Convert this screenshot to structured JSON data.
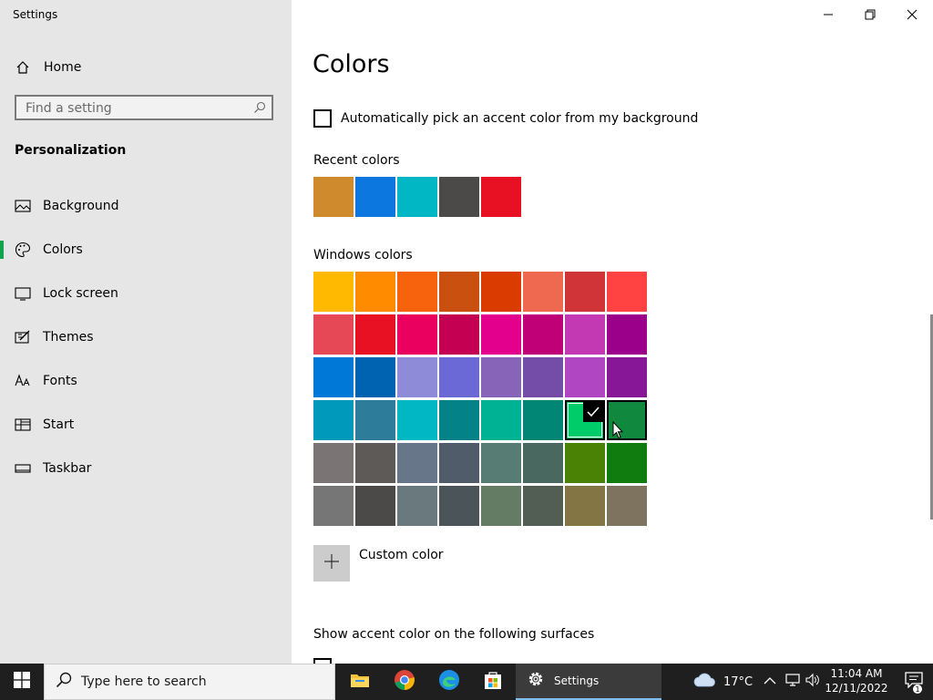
{
  "window": {
    "title": "Settings"
  },
  "sidebar": {
    "home_label": "Home",
    "search_placeholder": "Find a setting",
    "section_title": "Personalization",
    "items": [
      {
        "label": "Background",
        "icon": "image-icon"
      },
      {
        "label": "Colors",
        "icon": "palette-icon",
        "active": true
      },
      {
        "label": "Lock screen",
        "icon": "lock-screen-icon"
      },
      {
        "label": "Themes",
        "icon": "themes-icon"
      },
      {
        "label": "Fonts",
        "icon": "fonts-icon"
      },
      {
        "label": "Start",
        "icon": "start-icon"
      },
      {
        "label": "Taskbar",
        "icon": "taskbar-icon"
      }
    ]
  },
  "main": {
    "title": "Colors",
    "auto_pick_label": "Automatically pick an accent color from my background",
    "recent_label": "Recent colors",
    "recent_colors": [
      "#ce8a2d",
      "#0c77df",
      "#00b7c3",
      "#4b4a48",
      "#e81123"
    ],
    "windows_label": "Windows colors",
    "windows_colors": [
      [
        "#ffb900",
        "#ff8c00",
        "#f7630c",
        "#ca5010",
        "#da3b01",
        "#ef6950",
        "#d13438",
        "#ff4343"
      ],
      [
        "#e74856",
        "#e81123",
        "#ea005e",
        "#c30052",
        "#e3008c",
        "#bf0077",
        "#c239b3",
        "#9a0089"
      ],
      [
        "#0078d7",
        "#0063b1",
        "#8e8cd8",
        "#6b69d6",
        "#8764b8",
        "#744da9",
        "#b146c2",
        "#881798"
      ],
      [
        "#0099bc",
        "#2d7d9a",
        "#00b7c3",
        "#038387",
        "#00b294",
        "#018574",
        "#00cc6a",
        "#10893e"
      ],
      [
        "#7a7574",
        "#5d5a58",
        "#68768a",
        "#515c6b",
        "#567c73",
        "#486860",
        "#498205",
        "#107c10"
      ],
      [
        "#767676",
        "#4c4a48",
        "#69797e",
        "#4a5459",
        "#647c64",
        "#525e54",
        "#847545",
        "#7e735f"
      ]
    ],
    "selected_color": "#00cc6a",
    "custom_color_label": "Custom color",
    "surfaces_label": "Show accent color on the following surfaces"
  },
  "taskbar": {
    "search_placeholder": "Type here to search",
    "active_app_label": "Settings",
    "weather": "17°C",
    "time": "11:04 AM",
    "date": "12/11/2022",
    "notification_count": "1"
  }
}
